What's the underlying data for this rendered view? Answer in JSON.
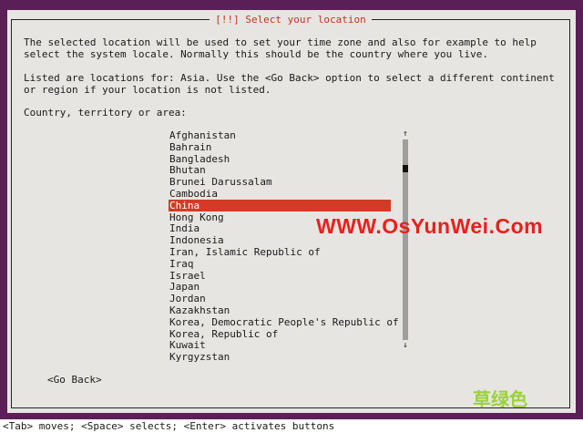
{
  "dialog": {
    "title": "[!!] Select your location",
    "paragraph1": "The selected location will be used to set your time zone and also for example to help\nselect the system locale. Normally this should be the country where you live.",
    "paragraph2": "Listed are locations for: Asia. Use the <Go Back> option to select a different continent\nor region if your location is not listed.",
    "list_label": "Country, territory or area:",
    "countries": [
      "Afghanistan",
      "Bahrain",
      "Bangladesh",
      "Bhutan",
      "Brunei Darussalam",
      "Cambodia",
      "China",
      "Hong Kong",
      "India",
      "Indonesia",
      "Iran, Islamic Republic of",
      "Iraq",
      "Israel",
      "Japan",
      "Jordan",
      "Kazakhstan",
      "Korea, Democratic People's Republic of",
      "Korea, Republic of",
      "Kuwait",
      "Kyrgyzstan"
    ],
    "selected": "China",
    "scroll_up_icon": "up-arrow-icon",
    "scroll_down_icon": "down-arrow-icon",
    "go_back_label": "<Go Back>"
  },
  "watermark": {
    "site": "WWW.OsYunWei.Com",
    "chinese": "草绿色"
  },
  "statusbar": {
    "text": "<Tab> moves; <Space> selects; <Enter> activates buttons"
  },
  "colors": {
    "background": "#5a1f56",
    "dialog": "#e7e5e2",
    "highlight": "#d43b24",
    "title": "#c4331e"
  }
}
